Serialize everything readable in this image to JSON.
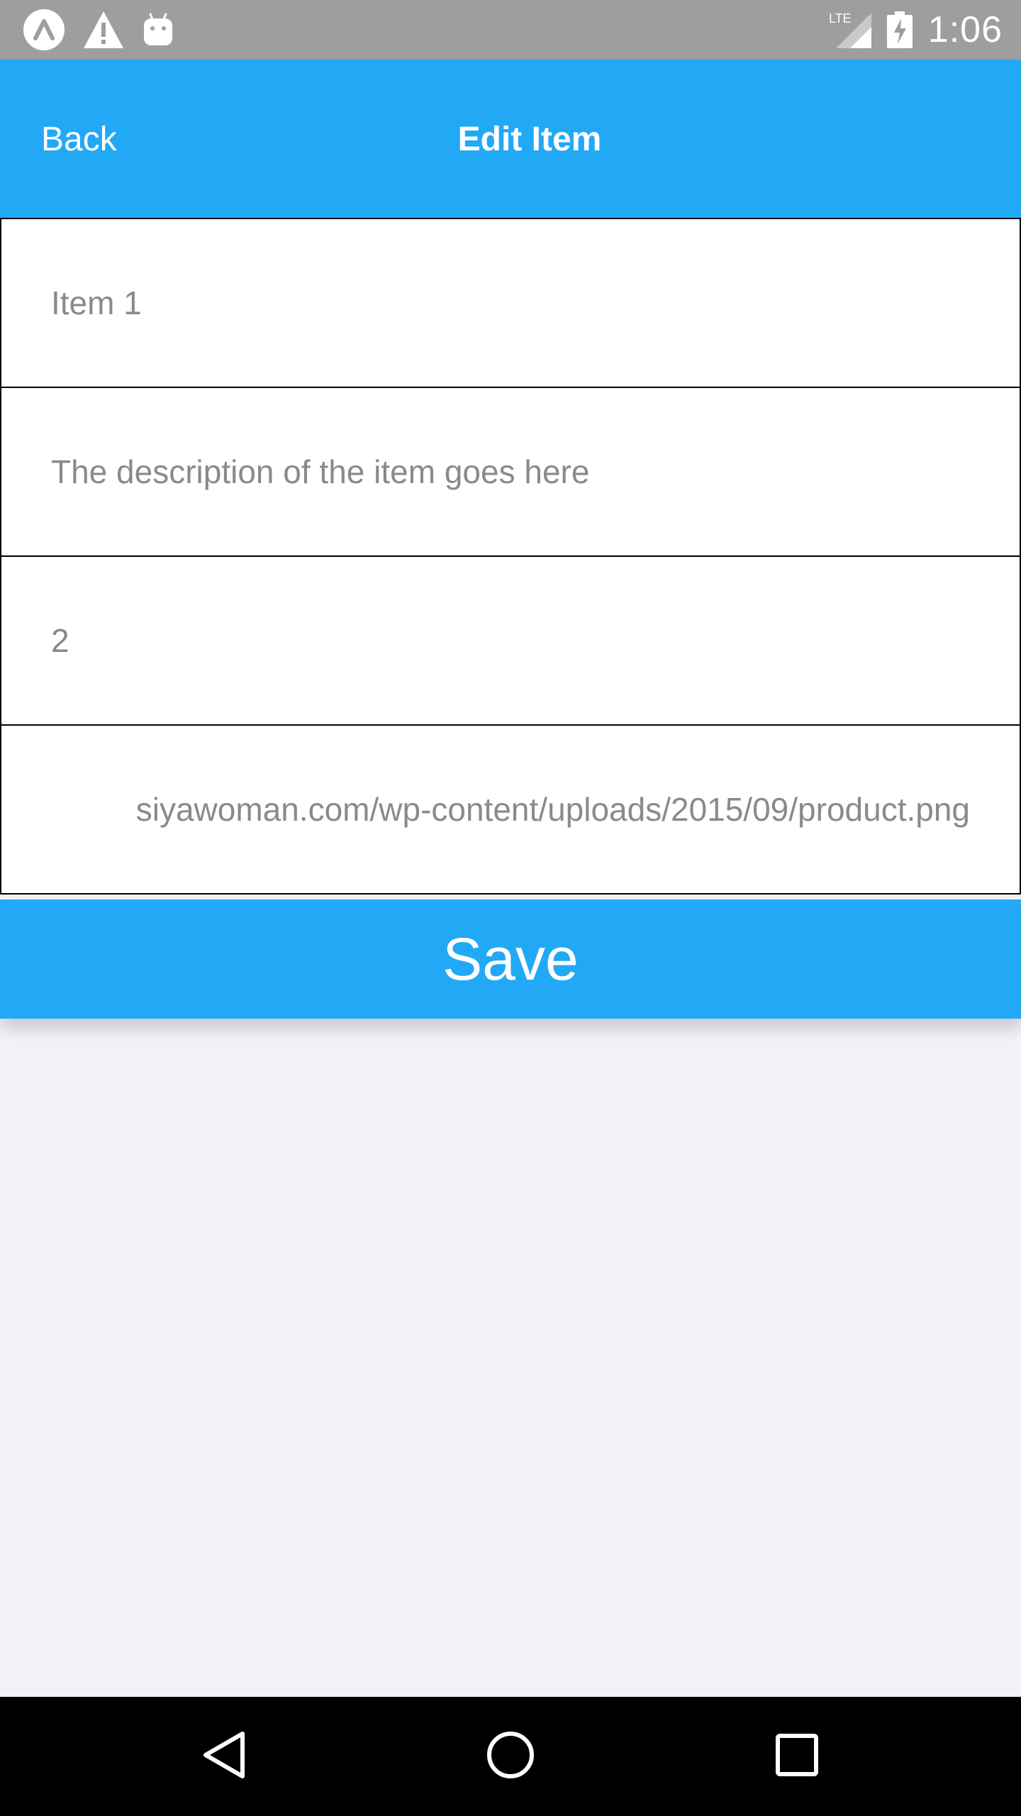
{
  "status_bar": {
    "icons_left": [
      "app-launcher-icon",
      "warning-icon",
      "android-icon"
    ],
    "network_label": "LTE",
    "icons_right": [
      "signal-icon",
      "battery-charging-icon"
    ],
    "time": "1:06"
  },
  "header": {
    "back_label": "Back",
    "title": "Edit Item"
  },
  "form": {
    "name_value": "Item 1",
    "description_value": "The description of the item goes here",
    "quantity_value": "2",
    "image_url_value": "siyawoman.com/wp-content/uploads/2015/09/product.png"
  },
  "save_label": "Save",
  "nav_bar": {
    "icons": [
      "back-triangle-icon",
      "home-circle-icon",
      "recents-square-icon"
    ]
  },
  "colors": {
    "accent": "#22a9f6",
    "status_bar": "#9e9d9f",
    "background": "#f5f2f7",
    "field_text": "#8a8a8a"
  }
}
